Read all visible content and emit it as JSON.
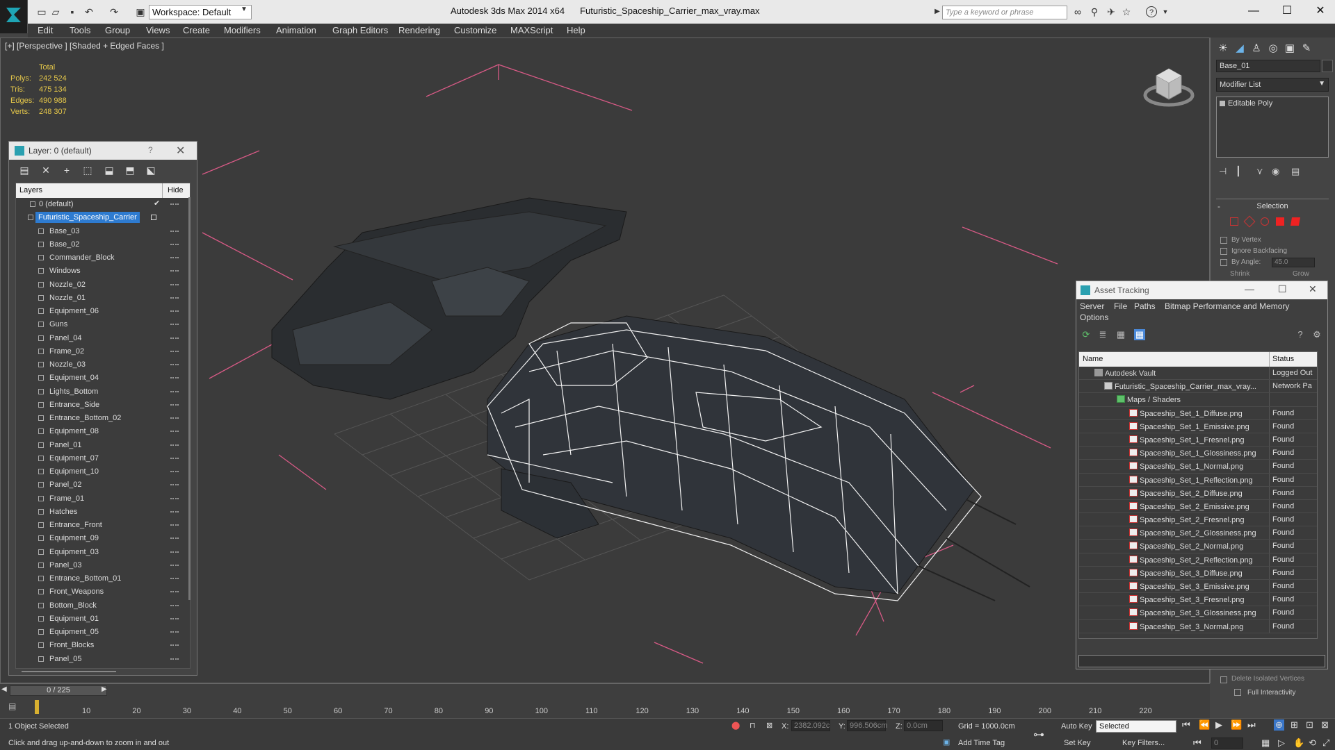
{
  "titlebar": {
    "workspace": "Workspace: Default",
    "app": "Autodesk 3ds Max  2014 x64",
    "file": "Futuristic_Spaceship_Carrier_max_vray.max",
    "search_placeholder": "Type a keyword or phrase"
  },
  "menu": [
    "Edit",
    "Tools",
    "Group",
    "Views",
    "Create",
    "Modifiers",
    "Animation",
    "Graph Editors",
    "Rendering",
    "Customize",
    "MAXScript",
    "Help"
  ],
  "viewport": {
    "label": "[+] [Perspective ] [Shaded + Edged Faces ]",
    "stats": {
      "header": "Total",
      "rows": [
        {
          "k": "Polys:",
          "v": "242 524"
        },
        {
          "k": "Tris:",
          "v": "475 134"
        },
        {
          "k": "Edges:",
          "v": "490 988"
        },
        {
          "k": "Verts:",
          "v": "248 307"
        }
      ]
    }
  },
  "layers": {
    "title": "Layer: 0 (default)",
    "help": "?",
    "col_layers": "Layers",
    "col_hide": "Hide",
    "default_layer": "0 (default)",
    "selected_layer": "Futuristic_Spaceship_Carrier",
    "objects": [
      "Base_03",
      "Base_02",
      "Commander_Block",
      "Windows",
      "Nozzle_02",
      "Nozzle_01",
      "Equipment_06",
      "Guns",
      "Panel_04",
      "Frame_02",
      "Nozzle_03",
      "Equipment_04",
      "Lights_Bottom",
      "Entrance_Side",
      "Entrance_Bottom_02",
      "Equipment_08",
      "Panel_01",
      "Equipment_07",
      "Equipment_10",
      "Panel_02",
      "Frame_01",
      "Hatches",
      "Entrance_Front",
      "Equipment_09",
      "Equipment_03",
      "Panel_03",
      "Entrance_Bottom_01",
      "Front_Weapons",
      "Bottom_Block",
      "Equipment_01",
      "Equipment_05",
      "Front_Blocks",
      "Panel_05"
    ]
  },
  "command_panel": {
    "object_name": "Base_01",
    "modifier_list": "Modifier List",
    "stack_item": "Editable Poly",
    "selection_head": "Selection",
    "by_vertex": "By Vertex",
    "ignore_backfacing": "Ignore Backfacing",
    "by_angle": "By Angle:",
    "angle_value": "45.0",
    "shrink": "Shrink",
    "grow": "Grow",
    "delete_isolated": "Delete Isolated Vertices",
    "full_interactivity": "Full Interactivity"
  },
  "asset_tracking": {
    "title": "Asset Tracking",
    "menu": [
      "Server",
      "File",
      "Paths",
      "Bitmap Performance and Memory",
      "Options"
    ],
    "col_name": "Name",
    "col_status": "Status",
    "vault": {
      "name": "Autodesk Vault",
      "status": "Logged Out"
    },
    "file": {
      "name": "Futuristic_Spaceship_Carrier_max_vray...",
      "status": "Network Pa"
    },
    "maps_folder": "Maps / Shaders",
    "maps": [
      {
        "name": "Spaceship_Set_1_Diffuse.png",
        "status": "Found"
      },
      {
        "name": "Spaceship_Set_1_Emissive.png",
        "status": "Found"
      },
      {
        "name": "Spaceship_Set_1_Fresnel.png",
        "status": "Found"
      },
      {
        "name": "Spaceship_Set_1_Glossiness.png",
        "status": "Found"
      },
      {
        "name": "Spaceship_Set_1_Normal.png",
        "status": "Found"
      },
      {
        "name": "Spaceship_Set_1_Reflection.png",
        "status": "Found"
      },
      {
        "name": "Spaceship_Set_2_Diffuse.png",
        "status": "Found"
      },
      {
        "name": "Spaceship_Set_2_Emissive.png",
        "status": "Found"
      },
      {
        "name": "Spaceship_Set_2_Fresnel.png",
        "status": "Found"
      },
      {
        "name": "Spaceship_Set_2_Glossiness.png",
        "status": "Found"
      },
      {
        "name": "Spaceship_Set_2_Normal.png",
        "status": "Found"
      },
      {
        "name": "Spaceship_Set_2_Reflection.png",
        "status": "Found"
      },
      {
        "name": "Spaceship_Set_3_Diffuse.png",
        "status": "Found"
      },
      {
        "name": "Spaceship_Set_3_Emissive.png",
        "status": "Found"
      },
      {
        "name": "Spaceship_Set_3_Fresnel.png",
        "status": "Found"
      },
      {
        "name": "Spaceship_Set_3_Glossiness.png",
        "status": "Found"
      },
      {
        "name": "Spaceship_Set_3_Normal.png",
        "status": "Found"
      }
    ]
  },
  "timeline": {
    "frame": "0 / 225",
    "ticks": [
      "10",
      "20",
      "30",
      "40",
      "50",
      "60",
      "70",
      "80",
      "90",
      "100",
      "110",
      "120",
      "130",
      "140",
      "150",
      "160",
      "170",
      "180",
      "190",
      "200",
      "210",
      "220"
    ]
  },
  "status": {
    "selected": "1 Object Selected",
    "hint": "Click and drag up-and-down to zoom in and out",
    "x_label": "X:",
    "x_value": "2382.092c",
    "y_label": "Y:",
    "y_value": "996.506cm",
    "z_label": "Z:",
    "z_value": "0.0cm",
    "grid": "Grid = 1000.0cm",
    "add_time_tag": "Add Time Tag",
    "auto_key": "Auto Key",
    "set_key": "Set Key",
    "selected_dd": "Selected",
    "key_filters": "Key Filters...",
    "current_frame": "0"
  },
  "colors": {
    "stats_text": "#e6c84a",
    "selection_blue": "#2e7bd0",
    "guide_pink": "#d85a86"
  }
}
